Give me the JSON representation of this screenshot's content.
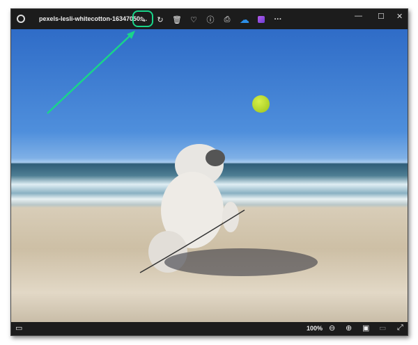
{
  "window": {
    "file_name": "pexels-lesli-whitecotton-16347050....",
    "zoom": "100%"
  },
  "toolbar": [
    "edit-image",
    "rotate",
    "delete",
    "favorite",
    "file-info",
    "print",
    "onedrive",
    "clipchamp",
    "more"
  ],
  "highlight_color": "#19d58a"
}
